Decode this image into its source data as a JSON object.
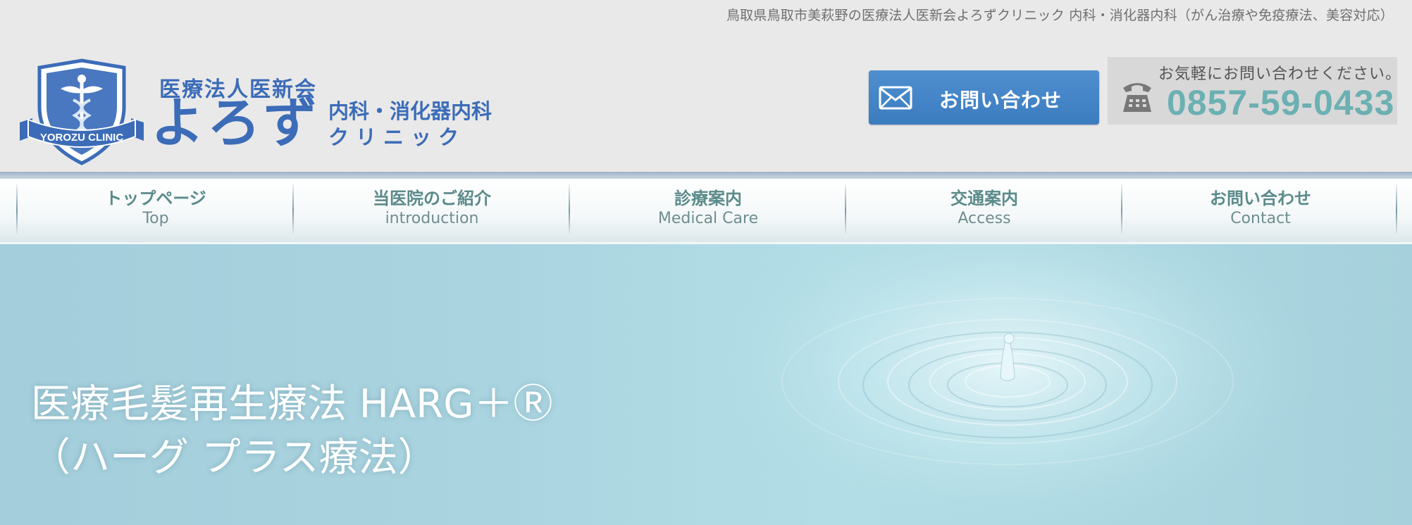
{
  "header": {
    "tagline": "鳥取県鳥取市美萩野の医療法人医新会よろずクリニック 内科・消化器内科（がん治療や免疫療法、美容対応）",
    "logo": {
      "org": "医療法人医新会",
      "name": "よろず",
      "dept": "内科・消化器内科",
      "sub": "クリニック",
      "emblem_text": "YOROZU CLINIC",
      "icon": "shield-caduceus-emblem"
    },
    "contact_button": {
      "label": "お問い合わせ",
      "icon": "envelope-icon"
    },
    "phone": {
      "caption": "お気軽にお問い合わせください。",
      "number": "0857-59-0433",
      "icon": "telephone-icon"
    }
  },
  "nav": {
    "items": [
      {
        "jp": "トップページ",
        "en": "Top"
      },
      {
        "jp": "当医院のご紹介",
        "en": "introduction"
      },
      {
        "jp": "診療案内",
        "en": "Medical Care"
      },
      {
        "jp": "交通案内",
        "en": "Access"
      },
      {
        "jp": "お問い合わせ",
        "en": "Contact"
      }
    ]
  },
  "hero": {
    "title_line1": "医療毛髪再生療法 HARG＋Ⓡ",
    "title_line2": "（ハーグ プラス療法）",
    "background": "water-drop-ripple"
  },
  "colors": {
    "brand_blue": "#3c6cb8",
    "button_blue": "#4385c7",
    "phone_teal": "#6bb0b2",
    "nav_text": "#5b8a8a",
    "hero_bg": "#acd6e1"
  }
}
